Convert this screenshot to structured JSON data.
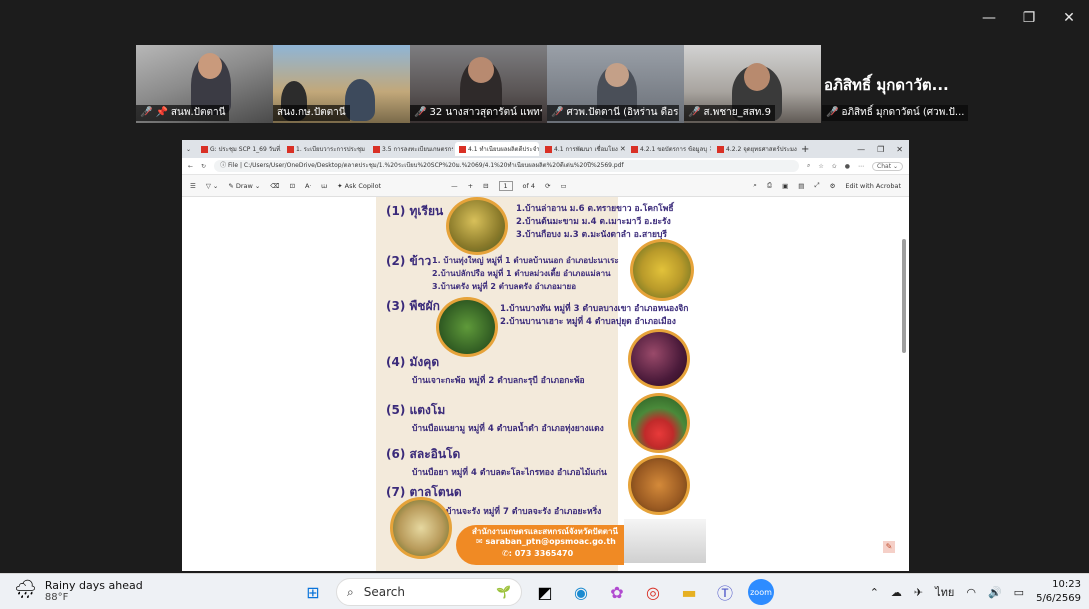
{
  "window_controls": {
    "minimize": "—",
    "restore": "❐",
    "close": "✕"
  },
  "participants": [
    {
      "name": "สนพ.ปัตตานี",
      "muted": true,
      "pinned": true
    },
    {
      "name": "สนง.กษ.ปัตตานี",
      "muted": false,
      "active": true
    },
    {
      "name": "32 นางสาวสุดารัตน์ แพทร...",
      "muted": true
    },
    {
      "name": "ศวพ.ปัตตานี (อิหร่าน ดือร...",
      "muted": true
    },
    {
      "name": "ส.พชาย_สสท.9",
      "muted": true
    }
  ],
  "speaker_tile": {
    "display_name": "อภิสิทธิ์ มุกดาวัต...",
    "label": "อภิสิทธิ์ มุกดาวัตน์ (ศวพ.ปั..."
  },
  "browser": {
    "tabs": [
      {
        "title": "G: ประชุม SCP 1_69 วันที่..."
      },
      {
        "title": "1. ระเบียบวาระการประชุม"
      },
      {
        "title": "3.5 การลงทะเบียนเกษตรกร"
      },
      {
        "title": "4.1 ทำเนียบผลผลิตดีประจำ",
        "active": true
      },
      {
        "title": "4.1 การพัฒนา เชื่อมโยง"
      },
      {
        "title": "4.2.1 ขอบัตรการ ข้อมูลบุ"
      },
      {
        "title": "4.2.2 จุดยุทธศาสตร์ประมง"
      }
    ],
    "new_tab": "+",
    "url_prefix": "File",
    "url": "C:/Users/User/OneDrive/Desktop/ตลาดประชุม/1.%20ระเบียบ%20SCP%20ม.%2069/4.1%20ทำเนียบผลผลิต%20ดีเด่น%20ปี%2569.pdf",
    "chat_label": "Chat"
  },
  "pdf_toolbar": {
    "draw": "Draw",
    "ask_copilot": "Ask Copilot",
    "page_current": "1",
    "page_total": "of 4",
    "edit_acrobat": "Edit with Acrobat"
  },
  "slide": {
    "sections": [
      {
        "num": "(1)",
        "title": "ทุเรียน",
        "lines": [
          "1.บ้านล่าอาน ม.6 ต.ทรายขาว อ.โคกโพธิ์",
          "2.บ้านต้นมะขาม ม.4 ต.เมาะมาวี อ.ยะรัง",
          "3.บ้านกือบง ม.3 ต.มะนังดาลำ อ.สายบุรี"
        ]
      },
      {
        "num": "(2)",
        "title": "ข้าว",
        "lines": [
          "1. บ้านทุ่งใหญ่ หมู่ที่ 1 ตำบลบ้านนอก อำเภอปะนาเระ",
          "2.บ้านปลักปรือ หมู่ที่ 1 ตำบลม่วงเตี้ย อำเภอแม่ลาน",
          "3.บ้านตรัง หมู่ที่ 2 ตำบลตรัง อำเภอมายอ"
        ]
      },
      {
        "num": "(3)",
        "title": "พืชผัก",
        "lines": [
          "1.บ้านบางทัน หมู่ที่ 3 ตำบลบางเขา อำเภอหนองจิก",
          "2.บ้านบานาเฮาะ หมู่ที่ 4 ตำบลปุยุด อำเภอเมือง"
        ]
      },
      {
        "num": "(4)",
        "title": "มังคุด",
        "lines": [
          "บ้านเจาะกะพ้อ หมู่ที่ 2 ตำบลกะรุบี อำเภอกะพ้อ"
        ]
      },
      {
        "num": "(5)",
        "title": "แตงโม",
        "lines": [
          "บ้านบือแนยามู หมู่ที่ 4 ตำบลน้ำดำ อำเภอทุ่งยางแดง"
        ]
      },
      {
        "num": "(6)",
        "title": "สละอินโด",
        "lines": [
          "บ้านบือยา หมู่ที่ 4 ตำบลตะโละไกรทอง อำเภอไม้แก่น"
        ]
      },
      {
        "num": "(7)",
        "title": "ตาลโตนด",
        "lines": [
          "บ้านจะรัง หมู่ที่ 7 ตำบลจะรัง อำเภอยะหริ่ง"
        ]
      }
    ],
    "footer": {
      "office": "สำนักงานเกษตรและสหกรณ์จังหวัดปัตตานี",
      "email": "saraban_ptn@opsmoac.go.th",
      "phone": ": 073 3365470"
    }
  },
  "taskbar": {
    "weather_title": "Rainy days ahead",
    "weather_temp": "88°F",
    "search_label": "Search",
    "language": "ไทย",
    "time": "10:23",
    "date": "5/6/2569"
  },
  "colors": {
    "slide_bg": "#f3eadb",
    "heading": "#3a2a7a",
    "footer_orange": "#f08a24",
    "active_tile": "#1fd3a0"
  }
}
